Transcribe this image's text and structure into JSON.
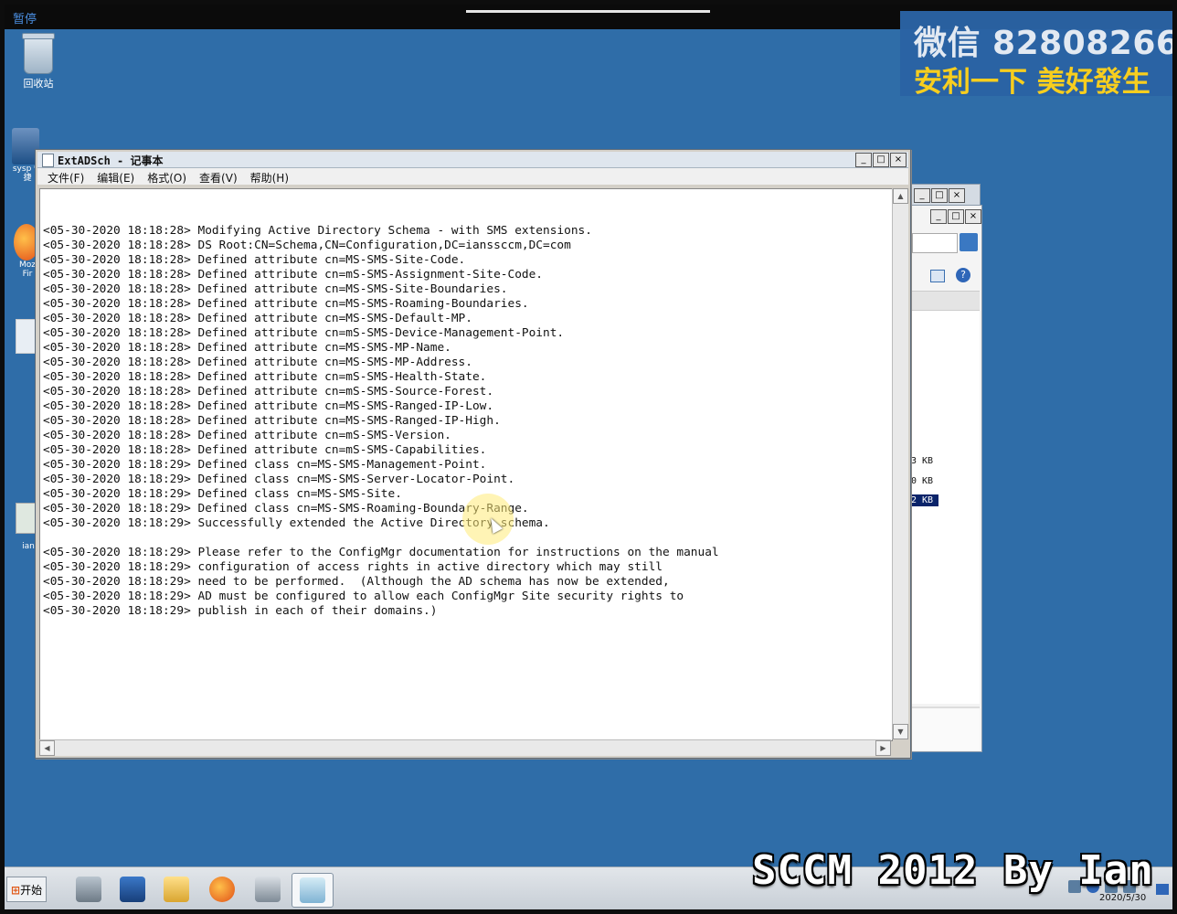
{
  "player": {
    "pause_label": "暂停"
  },
  "watermark": {
    "line1": "微信 82808266",
    "line2": "安利一下 美好發生"
  },
  "desktop": {
    "icons": [
      {
        "label": "回收站",
        "icon": "recycle-bin-icon"
      },
      {
        "label": "sysp 快捷",
        "icon": "network-shortcut-icon"
      },
      {
        "label": "Moz Fir",
        "icon": "firefox-icon"
      },
      {
        "label": "",
        "icon": "settings-shortcut-icon"
      },
      {
        "label": "ian",
        "icon": "file-shortcut-icon"
      }
    ]
  },
  "notepad": {
    "title": "ExtADSch - 记事本",
    "menu": [
      "文件(F)",
      "编辑(E)",
      "格式(O)",
      "查看(V)",
      "帮助(H)"
    ],
    "lines": [
      "",
      "<05-30-2020 18:18:28> Modifying Active Directory Schema - with SMS extensions.",
      "<05-30-2020 18:18:28> DS Root:CN=Schema,CN=Configuration,DC=ianssccm,DC=com",
      "<05-30-2020 18:18:28> Defined attribute cn=MS-SMS-Site-Code.",
      "<05-30-2020 18:18:28> Defined attribute cn=mS-SMS-Assignment-Site-Code.",
      "<05-30-2020 18:18:28> Defined attribute cn=MS-SMS-Site-Boundaries.",
      "<05-30-2020 18:18:28> Defined attribute cn=MS-SMS-Roaming-Boundaries.",
      "<05-30-2020 18:18:28> Defined attribute cn=MS-SMS-Default-MP.",
      "<05-30-2020 18:18:28> Defined attribute cn=mS-SMS-Device-Management-Point.",
      "<05-30-2020 18:18:28> Defined attribute cn=MS-SMS-MP-Name.",
      "<05-30-2020 18:18:28> Defined attribute cn=MS-SMS-MP-Address.",
      "<05-30-2020 18:18:28> Defined attribute cn=mS-SMS-Health-State.",
      "<05-30-2020 18:18:28> Defined attribute cn=mS-SMS-Source-Forest.",
      "<05-30-2020 18:18:28> Defined attribute cn=MS-SMS-Ranged-IP-Low.",
      "<05-30-2020 18:18:28> Defined attribute cn=MS-SMS-Ranged-IP-High.",
      "<05-30-2020 18:18:28> Defined attribute cn=mS-SMS-Version.",
      "<05-30-2020 18:18:28> Defined attribute cn=mS-SMS-Capabilities.",
      "<05-30-2020 18:18:29> Defined class cn=MS-SMS-Management-Point.",
      "<05-30-2020 18:18:29> Defined class cn=MS-SMS-Server-Locator-Point.",
      "<05-30-2020 18:18:29> Defined class cn=MS-SMS-Site.",
      "<05-30-2020 18:18:29> Defined class cn=MS-SMS-Roaming-Boundary-Range.",
      "<05-30-2020 18:18:29> Successfully extended the Active Directory schema.",
      "",
      "<05-30-2020 18:18:29> Please refer to the ConfigMgr documentation for instructions on the manual",
      "<05-30-2020 18:18:29> configuration of access rights in active directory which may still",
      "<05-30-2020 18:18:29> need to be performed.  (Although the AD schema has now be extended,",
      "<05-30-2020 18:18:29> AD must be configured to allow each ConfigMgr Site security rights to",
      "<05-30-2020 18:18:29> publish in each of their domains.)"
    ]
  },
  "background_window": {
    "file_sizes": [
      "3 KB",
      "0 KB",
      "2 KB"
    ]
  },
  "taskbar": {
    "start_label": "开始",
    "apps": [
      "server-manager-icon",
      "powershell-icon",
      "explorer-icon",
      "firefox-icon",
      "network-icon",
      "notepad-icon"
    ],
    "clock_date": "2020/5/30"
  },
  "caption": "SCCM 2012 By Ian"
}
